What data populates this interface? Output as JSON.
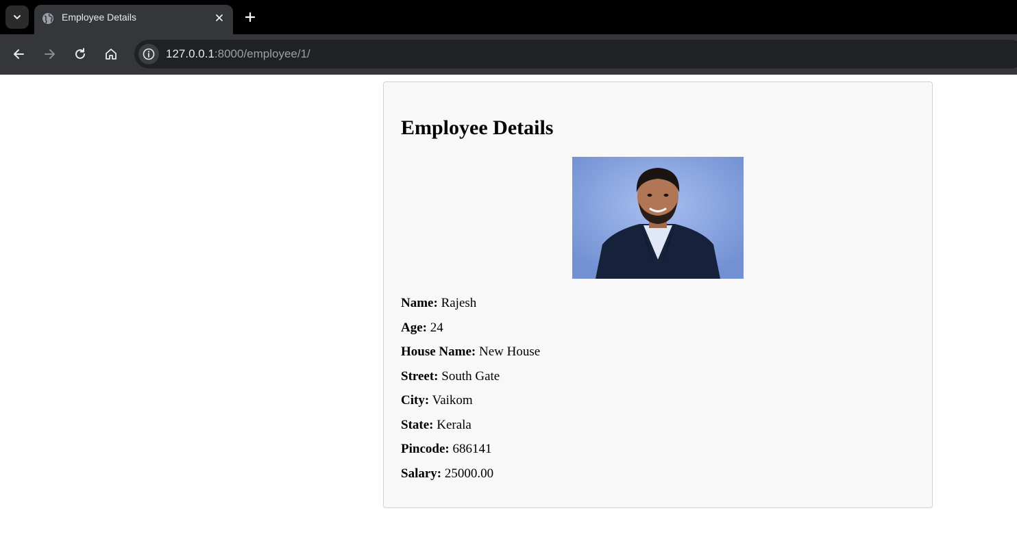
{
  "browser": {
    "tab_title": "Employee Details",
    "url_host": "127.0.0.1",
    "url_path": ":8000/employee/1/",
    "icons": {
      "tab_search": "chevron-down-icon",
      "favicon": "globe-icon",
      "close": "close-icon",
      "new_tab": "plus-icon",
      "back": "arrow-left-icon",
      "forward": "arrow-right-icon",
      "reload": "reload-icon",
      "home": "home-icon",
      "site_info": "info-icon"
    }
  },
  "page": {
    "title": "Employee Details",
    "photo": "employee-photo",
    "fields": [
      {
        "label": "Name:",
        "value": "Rajesh"
      },
      {
        "label": "Age:",
        "value": "24"
      },
      {
        "label": "House Name:",
        "value": "New House"
      },
      {
        "label": "Street:",
        "value": "South Gate"
      },
      {
        "label": "City:",
        "value": "Vaikom"
      },
      {
        "label": "State:",
        "value": "Kerala"
      },
      {
        "label": "Pincode:",
        "value": "686141"
      },
      {
        "label": "Salary:",
        "value": "25000.00"
      }
    ]
  },
  "colors": {
    "tabbar_bg": "#000000",
    "toolbar_bg": "#35363a",
    "omnibox_bg": "#202124",
    "card_bg": "#f8f8f8",
    "card_border": "#d2d2d2",
    "photo_bg": "#7a96d4"
  }
}
